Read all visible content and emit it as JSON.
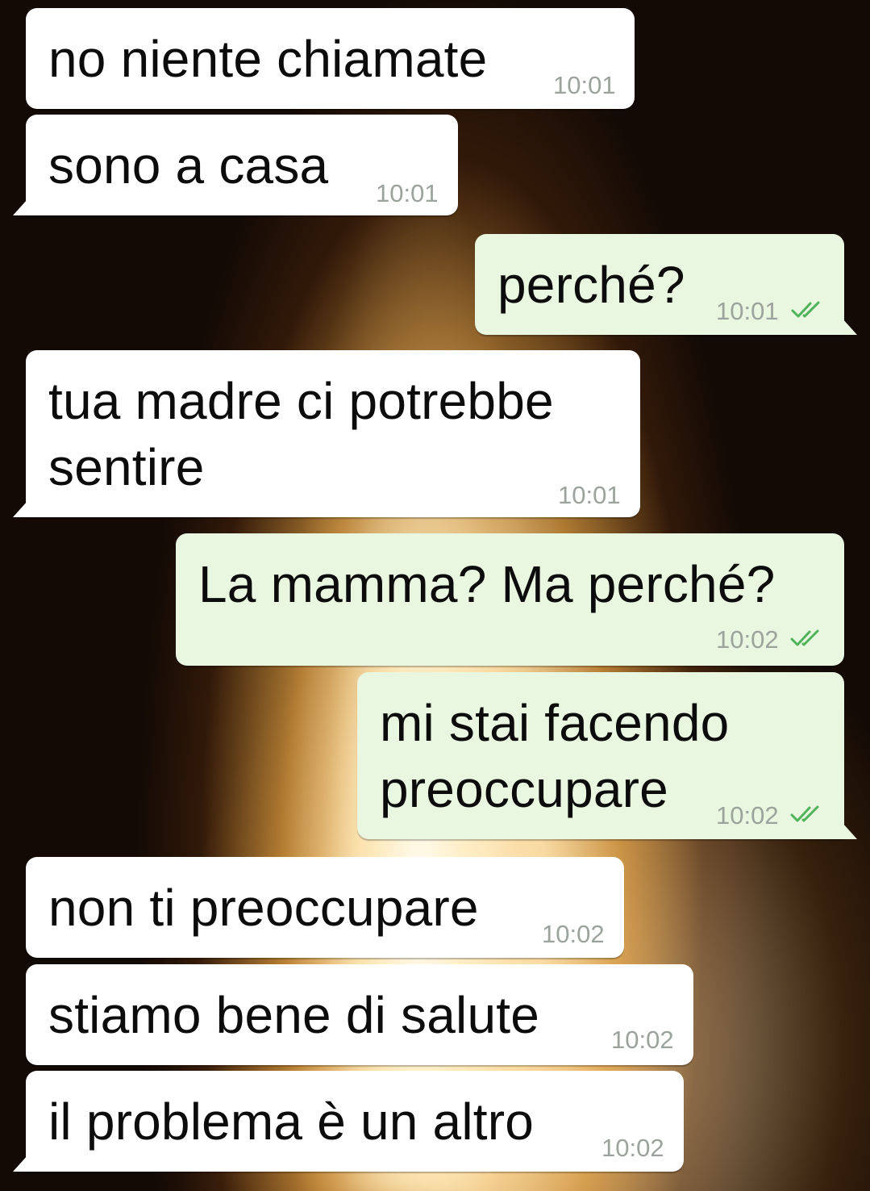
{
  "chat": {
    "messages": [
      {
        "text": "no niente chiamate",
        "time": "10:01",
        "direction": "incoming"
      },
      {
        "text": "sono a casa",
        "time": "10:01",
        "direction": "incoming"
      },
      {
        "text": "perché?",
        "time": "10:01",
        "direction": "outgoing",
        "status": "read",
        "status_icon": "double-check-icon"
      },
      {
        "text": "tua madre ci potrebbe\nsentire",
        "time": "10:01",
        "direction": "incoming"
      },
      {
        "text": "La mamma? Ma perché?",
        "time": "10:02",
        "direction": "outgoing",
        "status": "read",
        "status_icon": "double-check-icon"
      },
      {
        "text": "mi stai facendo\npreoccupare",
        "time": "10:02",
        "direction": "outgoing",
        "status": "read",
        "status_icon": "double-check-icon"
      },
      {
        "text": "non ti preoccupare",
        "time": "10:02",
        "direction": "incoming"
      },
      {
        "text": "stiamo bene di salute",
        "time": "10:02",
        "direction": "incoming"
      },
      {
        "text": "il problema è un altro",
        "time": "10:02",
        "direction": "incoming"
      }
    ]
  },
  "colors": {
    "incoming_bubble": "#ffffff",
    "outgoing_bubble": "#e9f6e0",
    "timestamp": "#9ca39c",
    "read_check": "#4fb35a"
  }
}
